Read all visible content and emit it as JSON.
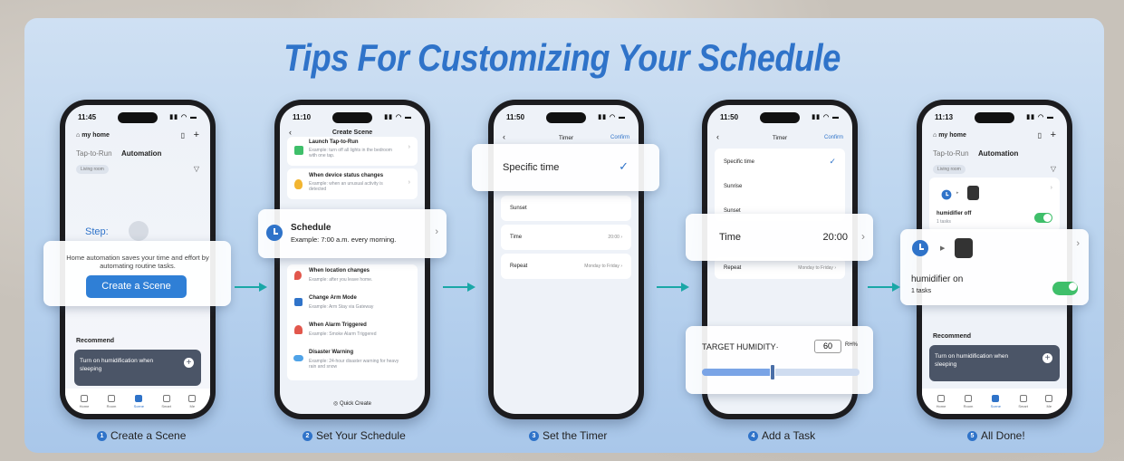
{
  "title": "Tips For Customizing Your Schedule",
  "steps": [
    {
      "num": "1",
      "label": "Create a Scene"
    },
    {
      "num": "2",
      "label": "Set Your Schedule"
    },
    {
      "num": "3",
      "label": "Set the Timer"
    },
    {
      "num": "4",
      "label": "Add a Task"
    },
    {
      "num": "5",
      "label": "All Done!"
    }
  ],
  "phone1": {
    "time": "11:45",
    "home": "my home",
    "tab_taprun": "Tap-to-Run",
    "tab_automation": "Automation",
    "room": "Living room",
    "step_label": "Step:",
    "popup_text": "Home automation saves your time and effort by automating routine tasks.",
    "create_button": "Create a Scene",
    "recommend": "Recommend",
    "rec_card": "Turn on humidification when sleeping",
    "tabs": [
      "Home",
      "Room",
      "Scene",
      "Smart",
      "Me"
    ]
  },
  "phone2": {
    "time": "11:10",
    "header": "Create Scene",
    "items": [
      {
        "title": "Launch Tap-to-Run",
        "desc": "Example: turn off all lights in the bedroom with one tap."
      },
      {
        "title": "When device status changes",
        "desc": "Example: when an unusual activity is detected"
      },
      {
        "title": "When location changes",
        "desc": "Example: after you leave home."
      },
      {
        "title": "Change Arm Mode",
        "desc": "Example: Arm Stay via Gateway"
      },
      {
        "title": "When Alarm Triggered",
        "desc": "Example: Smoke Alarm Triggered"
      },
      {
        "title": "Disaster Warning",
        "desc": "Example: 24-hour disaster warning for heavy rain and snow"
      }
    ],
    "popup_title": "Schedule",
    "popup_desc": "Example: 7:00 a.m. every morning.",
    "quick_create": "Quick Create"
  },
  "phone3": {
    "time": "11:50",
    "header": "Timer",
    "confirm": "Confirm",
    "popup": "Specific time",
    "rows": [
      "Sunset",
      "Time",
      "Repeat"
    ],
    "time_value": "20:00",
    "repeat_value": "Monday to Friday"
  },
  "phone4": {
    "time": "11:50",
    "header": "Timer",
    "confirm": "Confirm",
    "rows": [
      "Specific time",
      "Sunrise",
      "Sunset",
      "Repeat"
    ],
    "repeat_value": "Monday to Friday",
    "popup_time_label": "Time",
    "popup_time_value": "20:00",
    "humidity_label": "TARGET HUMIDITY·",
    "humidity_value": "60",
    "humidity_unit": "RH%",
    "humidity_level": 0.45
  },
  "phone5": {
    "time": "11:13",
    "home": "my home",
    "tab_taprun": "Tap-to-Run",
    "tab_automation": "Automation",
    "room": "Living room",
    "card1_title": "humidifier off",
    "card1_sub": "1 tasks",
    "popup_title": "humidifier on",
    "popup_sub": "1 tasks",
    "recommend": "Recommend",
    "rec_card": "Turn on humidification when sleeping",
    "tabs": [
      "Home",
      "Room",
      "Scene",
      "Smart",
      "Me"
    ]
  },
  "colors": {
    "accent": "#2f73c9",
    "arrow": "#1aa7a7",
    "toggle": "#3fbf6a"
  }
}
